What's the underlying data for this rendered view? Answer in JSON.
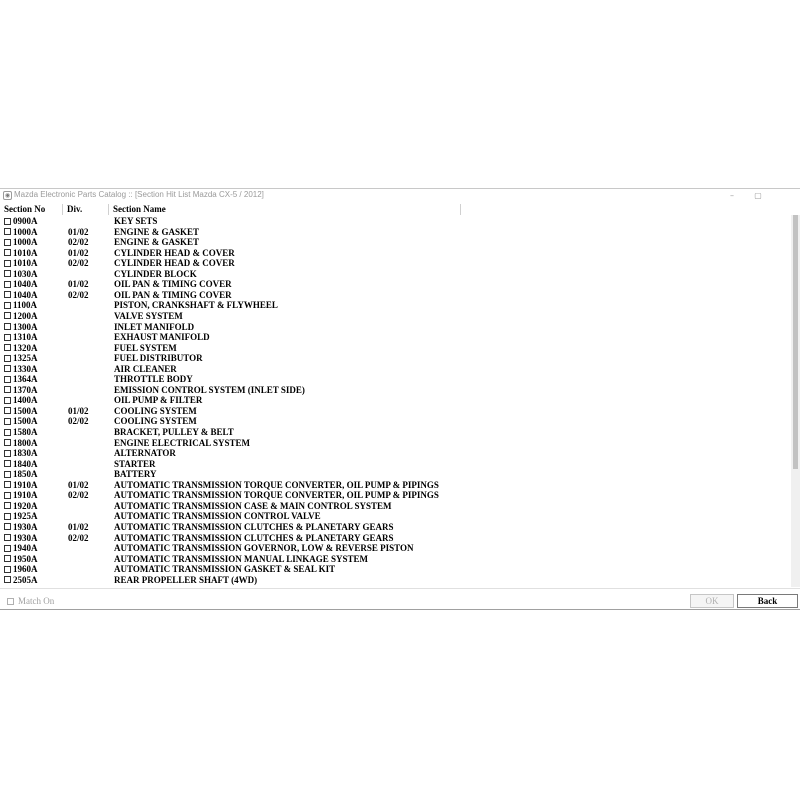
{
  "window": {
    "title": "Mazda Electronic Parts Catalog :: [Section Hit List Mazda CX-5 / 2012]",
    "minimize_glyph": "–",
    "maximize_glyph": "▢"
  },
  "columns": {
    "section_no": "Section No",
    "div": "Div.",
    "section_name": "Section Name"
  },
  "rows": [
    {
      "sec": "0900A",
      "div": "",
      "name": "KEY SETS"
    },
    {
      "sec": "1000A",
      "div": "01/02",
      "name": "ENGINE & GASKET"
    },
    {
      "sec": "1000A",
      "div": "02/02",
      "name": "ENGINE & GASKET"
    },
    {
      "sec": "1010A",
      "div": "01/02",
      "name": "CYLINDER HEAD & COVER"
    },
    {
      "sec": "1010A",
      "div": "02/02",
      "name": "CYLINDER HEAD & COVER"
    },
    {
      "sec": "1030A",
      "div": "",
      "name": "CYLINDER BLOCK"
    },
    {
      "sec": "1040A",
      "div": "01/02",
      "name": "OIL PAN & TIMING COVER"
    },
    {
      "sec": "1040A",
      "div": "02/02",
      "name": "OIL PAN & TIMING COVER"
    },
    {
      "sec": "1100A",
      "div": "",
      "name": "PISTON, CRANKSHAFT & FLYWHEEL"
    },
    {
      "sec": "1200A",
      "div": "",
      "name": "VALVE SYSTEM"
    },
    {
      "sec": "1300A",
      "div": "",
      "name": "INLET MANIFOLD"
    },
    {
      "sec": "1310A",
      "div": "",
      "name": "EXHAUST MANIFOLD"
    },
    {
      "sec": "1320A",
      "div": "",
      "name": "FUEL SYSTEM"
    },
    {
      "sec": "1325A",
      "div": "",
      "name": "FUEL DISTRIBUTOR"
    },
    {
      "sec": "1330A",
      "div": "",
      "name": "AIR CLEANER"
    },
    {
      "sec": "1364A",
      "div": "",
      "name": "THROTTLE BODY"
    },
    {
      "sec": "1370A",
      "div": "",
      "name": "EMISSION CONTROL SYSTEM (INLET SIDE)"
    },
    {
      "sec": "1400A",
      "div": "",
      "name": "OIL PUMP & FILTER"
    },
    {
      "sec": "1500A",
      "div": "01/02",
      "name": "COOLING SYSTEM"
    },
    {
      "sec": "1500A",
      "div": "02/02",
      "name": "COOLING SYSTEM"
    },
    {
      "sec": "1580A",
      "div": "",
      "name": "BRACKET, PULLEY & BELT"
    },
    {
      "sec": "1800A",
      "div": "",
      "name": "ENGINE ELECTRICAL SYSTEM"
    },
    {
      "sec": "1830A",
      "div": "",
      "name": "ALTERNATOR"
    },
    {
      "sec": "1840A",
      "div": "",
      "name": "STARTER"
    },
    {
      "sec": "1850A",
      "div": "",
      "name": "BATTERY"
    },
    {
      "sec": "1910A",
      "div": "01/02",
      "name": "AUTOMATIC TRANSMISSION TORQUE CONVERTER, OIL PUMP & PIPINGS"
    },
    {
      "sec": "1910A",
      "div": "02/02",
      "name": "AUTOMATIC TRANSMISSION TORQUE CONVERTER, OIL PUMP & PIPINGS"
    },
    {
      "sec": "1920A",
      "div": "",
      "name": "AUTOMATIC TRANSMISSION CASE & MAIN CONTROL SYSTEM"
    },
    {
      "sec": "1925A",
      "div": "",
      "name": "AUTOMATIC TRANSMISSION CONTROL VALVE"
    },
    {
      "sec": "1930A",
      "div": "01/02",
      "name": "AUTOMATIC TRANSMISSION CLUTCHES & PLANETARY GEARS"
    },
    {
      "sec": "1930A",
      "div": "02/02",
      "name": "AUTOMATIC TRANSMISSION CLUTCHES & PLANETARY GEARS"
    },
    {
      "sec": "1940A",
      "div": "",
      "name": "AUTOMATIC TRANSMISSION GOVERNOR, LOW & REVERSE PISTON"
    },
    {
      "sec": "1950A",
      "div": "",
      "name": "AUTOMATIC TRANSMISSION MANUAL LINKAGE SYSTEM"
    },
    {
      "sec": "1960A",
      "div": "",
      "name": "AUTOMATIC TRANSMISSION GASKET & SEAL KIT"
    },
    {
      "sec": "2505A",
      "div": "",
      "name": "REAR PROPELLER SHAFT (4WD)"
    }
  ],
  "footer": {
    "match_on_label": "Match On",
    "ok_label": "OK",
    "back_label": "Back"
  },
  "icons": {
    "app": "app-icon",
    "minimize": "minimize-icon",
    "maximize": "maximize-icon"
  }
}
